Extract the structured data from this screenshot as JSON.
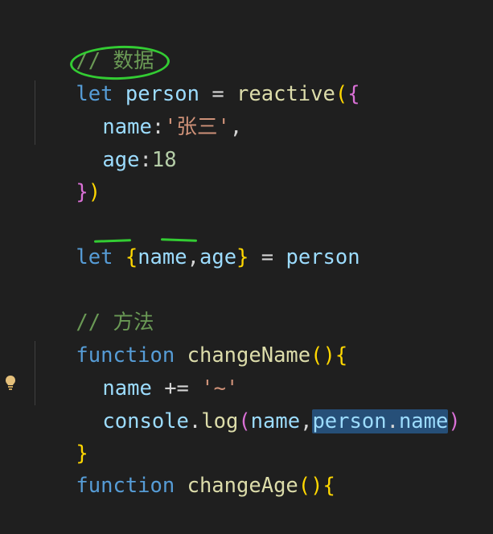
{
  "code": {
    "line1_comment": "// 数据",
    "line2": {
      "kw": "let",
      "var": "person",
      "eq": " = ",
      "fn": "reactive",
      "paren_open": "(",
      "brace_open": "{"
    },
    "line3": {
      "key": "name",
      "colon": ":",
      "value": "'张三'",
      "comma": ","
    },
    "line4": {
      "key": "age",
      "colon": ":",
      "value": "18"
    },
    "line5": {
      "brace_close": "}",
      "paren_close": ")"
    },
    "line7": {
      "kw": "let",
      "brace_open": "{",
      "var1": "name",
      "comma": ",",
      "var2": "age",
      "brace_close": "}",
      "eq": " = ",
      "rhs": "person"
    },
    "line9_comment": "// 方法",
    "line10": {
      "kw": "function",
      "fn": "changeName",
      "parens": "()",
      "brace_open": "{"
    },
    "line11": {
      "var": "name",
      "op": " += ",
      "str": "'~'"
    },
    "line12": {
      "obj": "console",
      "dot": ".",
      "fn": "log",
      "paren_open": "(",
      "arg1": "name",
      "comma": ",",
      "arg2_obj": "person",
      "arg2_dot": ".",
      "arg2_prop": "name",
      "paren_close": ")"
    },
    "line13": {
      "brace_close": "}"
    },
    "line14": {
      "kw": "function",
      "fn": " changeAge",
      "parens": "(){"
    }
  },
  "colors": {
    "background": "#1f1f1f",
    "comment": "#6a9955",
    "keyword": "#569cd6",
    "variable": "#9cdcfe",
    "function": "#dcdcaa",
    "string": "#ce9178",
    "number": "#b5cea8",
    "selection": "#264f78",
    "annotation": "#33cc33"
  },
  "icons": {
    "lightbulb": "lightbulb-icon"
  }
}
